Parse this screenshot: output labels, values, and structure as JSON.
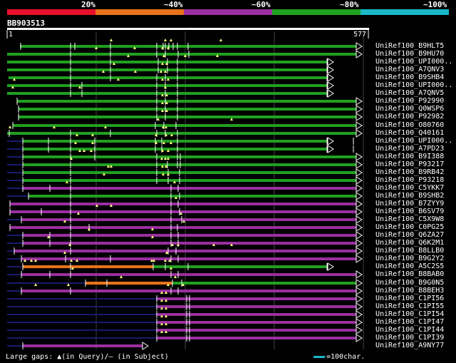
{
  "query_id": "BB903513",
  "ruler": {
    "start": "1",
    "end": "577"
  },
  "identity_scale": [
    {
      "label": "20%",
      "color": "#e8102a"
    },
    {
      "label": "~40%",
      "color": "#e8731a"
    },
    {
      "label": "~60%",
      "color": "#9a2f9f"
    },
    {
      "label": "~80%",
      "color": "#20a020"
    },
    {
      "label": "~100%",
      "color": "#1ab8c8"
    }
  ],
  "footer": {
    "gaps_text": "Large gaps: ▲(in Query)/– (in Subject)",
    "scale_text": "=100char."
  },
  "colors": {
    "green": "#20a020",
    "purple": "#9a2f9f",
    "orange": "#e8731a",
    "white": "#ffffff",
    "navy": "#1a1a6e",
    "yellow": "#ffff80",
    "cyan": "#1ab8c8"
  },
  "rows": [
    {
      "name": "UniRef100_B9HLT5",
      "segs": [
        [
          "green",
          28,
          500
        ]
      ],
      "gaps": [
        29,
        99,
        105,
        155,
        220,
        229,
        232,
        237,
        243,
        249,
        264
      ],
      "tri": [
        156,
        232,
        240,
        310
      ]
    },
    {
      "name": "UniRef100_B9HU70",
      "segs": [
        [
          "green",
          10,
          500
        ]
      ],
      "gaps": [
        99,
        155,
        220,
        232,
        250,
        265
      ],
      "tri": [
        135,
        189,
        228,
        236
      ]
    },
    {
      "name": "UniRef100_UPI000..",
      "segs": [
        [
          "green",
          10,
          460
        ]
      ],
      "gaps": [
        99,
        155,
        222,
        235,
        249,
        459
      ],
      "tri": [
        180,
        230,
        260,
        305
      ]
    },
    {
      "name": "UniRef100_A7QNV3",
      "segs": [
        [
          "green",
          10,
          460
        ]
      ],
      "gaps": [
        99,
        155,
        222,
        235,
        249,
        459
      ],
      "tri": [
        160,
        228,
        234
      ]
    },
    {
      "name": "UniRef100_B9SHB4",
      "segs": [
        [
          "green",
          12,
          460
        ]
      ],
      "gaps": [
        99,
        155,
        220,
        232,
        249,
        459
      ],
      "tri": [
        145,
        190,
        226,
        232
      ]
    },
    {
      "name": "UniRef100_UPI000..",
      "segs": [
        [
          "green",
          10,
          460
        ]
      ],
      "gaps": [
        99,
        115,
        220,
        232,
        249,
        459
      ],
      "tri": [
        20,
        166,
        228,
        236
      ]
    },
    {
      "name": "UniRef100_A7QNV5",
      "segs": [
        [
          "green",
          10,
          460
        ]
      ],
      "gaps": [
        99,
        115,
        220,
        232,
        249,
        459
      ],
      "tri": [
        18,
        112,
        232
      ]
    },
    {
      "name": "UniRef100_P92990",
      "segs": [
        [
          "green",
          24,
          500
        ]
      ],
      "gaps": [
        24,
        220,
        232,
        249
      ],
      "tri": [
        228,
        234
      ]
    },
    {
      "name": "UniRef100_Q0WSP6",
      "segs": [
        [
          "green",
          26,
          500
        ]
      ],
      "gaps": [
        26,
        220,
        232,
        249
      ],
      "tri": [
        228,
        234
      ]
    },
    {
      "name": "UniRef100_P92982",
      "segs": [
        [
          "green",
          26,
          500
        ]
      ],
      "gaps": [
        26,
        220,
        232,
        249
      ],
      "tri": [
        228,
        234
      ]
    },
    {
      "name": "UniRef100_O80760",
      "segs": [
        [
          "green",
          18,
          500
        ]
      ],
      "gaps": [
        18,
        218,
        230,
        247
      ],
      "tri": [
        222,
        325
      ]
    },
    {
      "name": "UniRef100_Q40161",
      "segs": [
        [
          "green",
          10,
          500
        ]
      ],
      "gaps": [
        13,
        99,
        155,
        220,
        232,
        249
      ],
      "tri": [
        14,
        76,
        148,
        229,
        233
      ]
    },
    {
      "name": "UniRef100_UPI000..",
      "segs": [
        [
          "navy",
          10,
          32
        ],
        [
          "green",
          32,
          460
        ]
      ],
      "gaps": [
        32,
        68,
        99,
        133,
        218,
        227,
        249,
        459,
        496
      ],
      "tri": [
        108,
        130,
        219,
        233,
        241
      ]
    },
    {
      "name": "UniRef100_A7PD23",
      "segs": [
        [
          "navy",
          10,
          32
        ],
        [
          "green",
          32,
          460
        ]
      ],
      "gaps": [
        32,
        68,
        99,
        133,
        218,
        227,
        249,
        459,
        496
      ],
      "tri": [
        106,
        130,
        219,
        230,
        240
      ]
    },
    {
      "name": "UniRef100_B9I388",
      "segs": [
        [
          "navy",
          10,
          32
        ],
        [
          "green",
          32,
          500
        ]
      ],
      "gaps": [
        32,
        99,
        133,
        220,
        249,
        253
      ],
      "tri": [
        112,
        118,
        128,
        228,
        236
      ]
    },
    {
      "name": "UniRef100_P93217",
      "segs": [
        [
          "navy",
          10,
          32
        ],
        [
          "green",
          32,
          500
        ]
      ],
      "gaps": [
        32,
        99,
        220,
        235,
        249,
        253
      ],
      "tri": [
        100,
        227,
        232,
        236
      ]
    },
    {
      "name": "UniRef100_B9RB42",
      "segs": [
        [
          "navy",
          10,
          32
        ],
        [
          "green",
          32,
          500
        ]
      ],
      "gaps": [
        32,
        99,
        220,
        236,
        252
      ],
      "tri": [
        152,
        156,
        228,
        233
      ]
    },
    {
      "name": "UniRef100_P93218",
      "segs": [
        [
          "navy",
          10,
          32
        ],
        [
          "green",
          32,
          500
        ]
      ],
      "gaps": [
        32,
        99,
        220,
        236,
        252
      ],
      "tri": [
        146,
        229,
        236
      ]
    },
    {
      "name": "UniRef100_C5YKK7",
      "segs": [
        [
          "navy",
          10,
          32
        ],
        [
          "purple",
          32,
          500
        ]
      ],
      "gaps": [
        32,
        70,
        99,
        240,
        250
      ],
      "tri": [
        94,
        245
      ]
    },
    {
      "name": "UniRef100_B9SHB2",
      "segs": [
        [
          "navy",
          10,
          40
        ],
        [
          "green",
          40,
          500
        ]
      ],
      "gaps": [
        40,
        99,
        240,
        252
      ],
      "tri": []
    },
    {
      "name": "UniRef100_B7ZYY9",
      "segs": [
        [
          "purple",
          14,
          500
        ]
      ],
      "gaps": [
        14,
        99,
        240,
        250
      ],
      "tri": [
        247
      ]
    },
    {
      "name": "UniRef100_B6SV79",
      "segs": [
        [
          "purple",
          14,
          500
        ]
      ],
      "gaps": [
        14,
        58,
        99,
        240,
        252
      ],
      "tri": [
        136,
        156
      ]
    },
    {
      "name": "UniRef100_C5X9W8",
      "segs": [
        [
          "navy",
          10,
          30
        ],
        [
          "purple",
          30,
          500
        ]
      ],
      "gaps": [
        30,
        99,
        240,
        255
      ],
      "tri": [
        110,
        254
      ]
    },
    {
      "name": "UniRef100_C0PG25",
      "segs": [
        [
          "purple",
          14,
          500
        ]
      ],
      "gaps": [
        14,
        99,
        125,
        240,
        249
      ],
      "tri": [
        91,
        258
      ]
    },
    {
      "name": "UniRef100_Q6ZA27",
      "segs": [
        [
          "navy",
          10,
          32
        ],
        [
          "purple",
          32,
          500
        ]
      ],
      "gaps": [
        32,
        70,
        99,
        240,
        250
      ],
      "tri": [
        125,
        214
      ]
    },
    {
      "name": "UniRef100_Q6K2M1",
      "segs": [
        [
          "navy",
          10,
          32
        ],
        [
          "purple",
          32,
          500
        ]
      ],
      "gaps": [
        32,
        70,
        99,
        240,
        250
      ],
      "tri": [
        68,
        214
      ]
    },
    {
      "name": "UniRef100_B8LLB0",
      "segs": [
        [
          "navy",
          10,
          20
        ],
        [
          "purple",
          20,
          500
        ]
      ],
      "gaps": [
        20,
        99,
        236,
        247
      ],
      "tri": [
        98,
        242,
        250,
        300,
        325
      ]
    },
    {
      "name": "UniRef100_B9G2Y2",
      "segs": [
        [
          "navy",
          10,
          30
        ],
        [
          "purple",
          30,
          500
        ]
      ],
      "gaps": [
        30,
        92,
        155,
        240,
        250
      ],
      "tri": [
        91,
        234
      ]
    },
    {
      "name": "UniRef100_A5C2S5",
      "segs": [
        [
          "navy",
          10,
          32
        ],
        [
          "orange",
          32,
          215
        ],
        [
          "green",
          215,
          460
        ]
      ],
      "gaps": [
        32,
        99,
        215,
        232,
        264,
        459
      ],
      "tri": [
        35,
        44,
        50,
        100,
        108,
        213,
        216,
        232,
        238
      ]
    },
    {
      "name": "UniRef100_B8BAB0",
      "segs": [
        [
          "navy",
          10,
          30
        ],
        [
          "purple",
          30,
          500
        ]
      ],
      "gaps": [
        30,
        70,
        99,
        240,
        250
      ],
      "tri": [
        102,
        240
      ]
    },
    {
      "name": "UniRef100_B9G0N5",
      "segs": [
        [
          "navy",
          10,
          120
        ],
        [
          "orange",
          120,
          242
        ],
        [
          "green",
          242,
          500
        ]
      ],
      "gaps": [
        120,
        150,
        242,
        255
      ],
      "tri": [
        170,
        246
      ]
    },
    {
      "name": "UniRef100_B8BEH3",
      "segs": [
        [
          "navy",
          10,
          30
        ],
        [
          "purple",
          30,
          500
        ]
      ],
      "gaps": [
        30,
        99,
        240,
        250
      ],
      "tri": [
        50,
        96,
        236,
        257
      ]
    },
    {
      "name": "UniRef100_C1PI56",
      "segs": [
        [
          "navy",
          10,
          220
        ],
        [
          "purple",
          220,
          500
        ]
      ],
      "gaps": [
        220,
        262,
        266
      ],
      "tri": [
        227,
        233
      ]
    },
    {
      "name": "UniRef100_C1PI55",
      "segs": [
        [
          "navy",
          10,
          220
        ],
        [
          "purple",
          220,
          500
        ]
      ],
      "gaps": [
        220,
        262,
        266
      ],
      "tri": [
        227,
        233
      ]
    },
    {
      "name": "UniRef100_C1PI54",
      "segs": [
        [
          "navy",
          10,
          220
        ],
        [
          "purple",
          220,
          500
        ]
      ],
      "gaps": [
        220,
        262,
        266
      ],
      "tri": [
        227,
        233
      ]
    },
    {
      "name": "UniRef100_C1PI47",
      "segs": [
        [
          "navy",
          10,
          220
        ],
        [
          "purple",
          220,
          500
        ]
      ],
      "gaps": [
        220,
        262,
        266
      ],
      "tri": [
        227,
        233
      ]
    },
    {
      "name": "UniRef100_C1PI44",
      "segs": [
        [
          "navy",
          10,
          220
        ],
        [
          "purple",
          220,
          500
        ]
      ],
      "gaps": [
        220,
        262,
        266
      ],
      "tri": [
        227,
        233
      ]
    },
    {
      "name": "UniRef100_C1PI39",
      "segs": [
        [
          "navy",
          10,
          220
        ],
        [
          "purple",
          220,
          500
        ]
      ],
      "gaps": [
        220,
        262,
        266
      ],
      "tri": [
        227,
        233
      ]
    },
    {
      "name": "UniRef100_A9NY77",
      "segs": [
        [
          "navy",
          10,
          32
        ],
        [
          "purple",
          32,
          200
        ]
      ],
      "gaps": [
        32
      ],
      "tri": []
    }
  ]
}
